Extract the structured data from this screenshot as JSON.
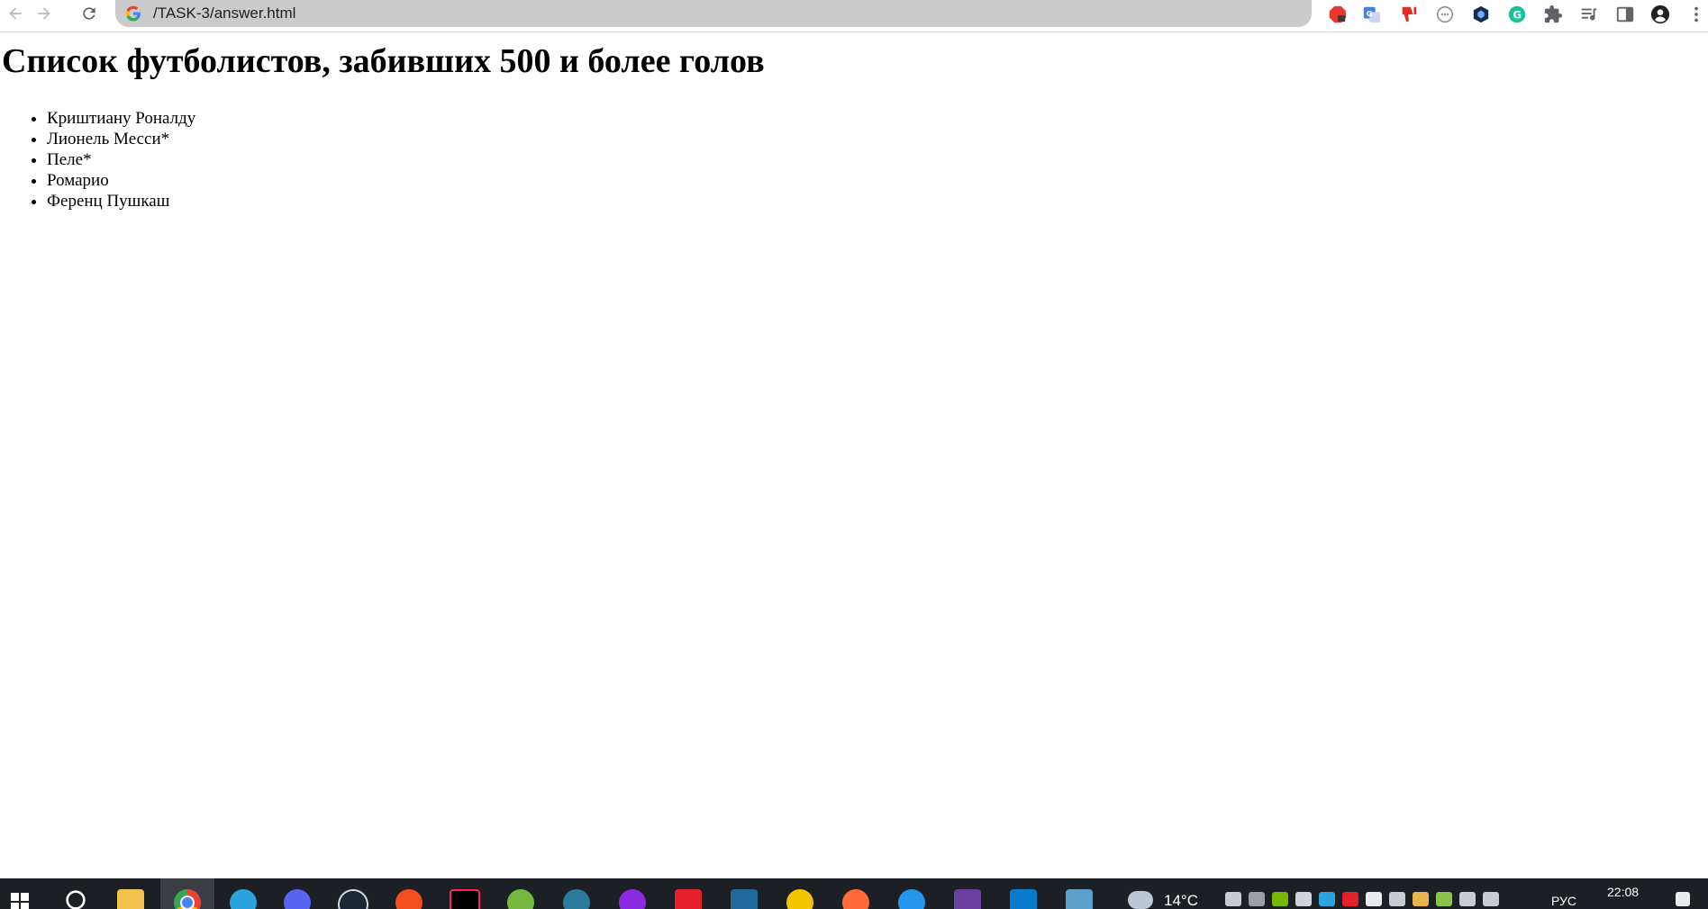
{
  "browser": {
    "url": "/TASK-3/answer.html",
    "icons": [
      "back-arrow-icon",
      "forward-arrow-icon",
      "reload-icon",
      "google-logo-icon"
    ],
    "extensions": [
      {
        "name": "adblock-extension-icon",
        "color": "#e8372c"
      },
      {
        "name": "translate-extension-icon",
        "color": "#4a7fe0"
      },
      {
        "name": "dislike-extension-icon",
        "color": "#e52d27"
      },
      {
        "name": "circle-dots-extension-icon",
        "color": "#9aa0a6"
      },
      {
        "name": "hex-extension-icon",
        "color": "#1a2a4a"
      },
      {
        "name": "grammarly-extension-icon",
        "color": "#15c39a"
      },
      {
        "name": "puzzle-extensions-icon",
        "color": "#5f6368"
      },
      {
        "name": "media-control-icon",
        "color": "#5f6368"
      },
      {
        "name": "side-panel-icon",
        "color": "#5f6368"
      },
      {
        "name": "profile-avatar-icon",
        "color": "#202124"
      },
      {
        "name": "kebab-menu-icon",
        "color": "#5f6368"
      }
    ]
  },
  "page": {
    "heading": "Список футболистов, забивших 500 и более голов",
    "players": [
      "Криштиану Роналду",
      "Лионель Месси*",
      "Пеле*",
      "Ромарио",
      "Ференц Пушкаш"
    ]
  },
  "taskbar": {
    "weather": "14°C",
    "language": "РУС",
    "time": "22:08",
    "apps": [
      {
        "name": "windows-start-icon",
        "color": "#ffffff"
      },
      {
        "name": "search-icon",
        "color": "#ffffff"
      },
      {
        "name": "file-explorer-icon",
        "color": "#f2c14e"
      },
      {
        "name": "chrome-icon",
        "color": "#ea4335"
      },
      {
        "name": "telegram-icon",
        "color": "#2aa3df"
      },
      {
        "name": "discord-icon",
        "color": "#5865f2"
      },
      {
        "name": "steam-icon",
        "color": "#1b2838"
      },
      {
        "name": "ea-icon",
        "color": "#f24e1e"
      },
      {
        "name": "intellij-icon",
        "color": "#000000"
      },
      {
        "name": "utorrent-icon",
        "color": "#76b83f"
      },
      {
        "name": "earth-app-icon",
        "color": "#2b7a9b"
      },
      {
        "name": "podcast-app-icon",
        "color": "#8a2be2"
      },
      {
        "name": "bitdefender-icon",
        "color": "#e3202b"
      },
      {
        "name": "mysql-workbench-icon",
        "color": "#1e6b9b"
      },
      {
        "name": "chatgpt-icon",
        "color": "#f2c500"
      },
      {
        "name": "postman-icon",
        "color": "#ff6c37"
      },
      {
        "name": "docker-icon",
        "color": "#2496ed"
      },
      {
        "name": "git-tool-icon",
        "color": "#6a3fa0"
      },
      {
        "name": "vscode-icon",
        "color": "#0a7acc"
      },
      {
        "name": "notepad-icon",
        "color": "#5aa0c8"
      }
    ]
  }
}
